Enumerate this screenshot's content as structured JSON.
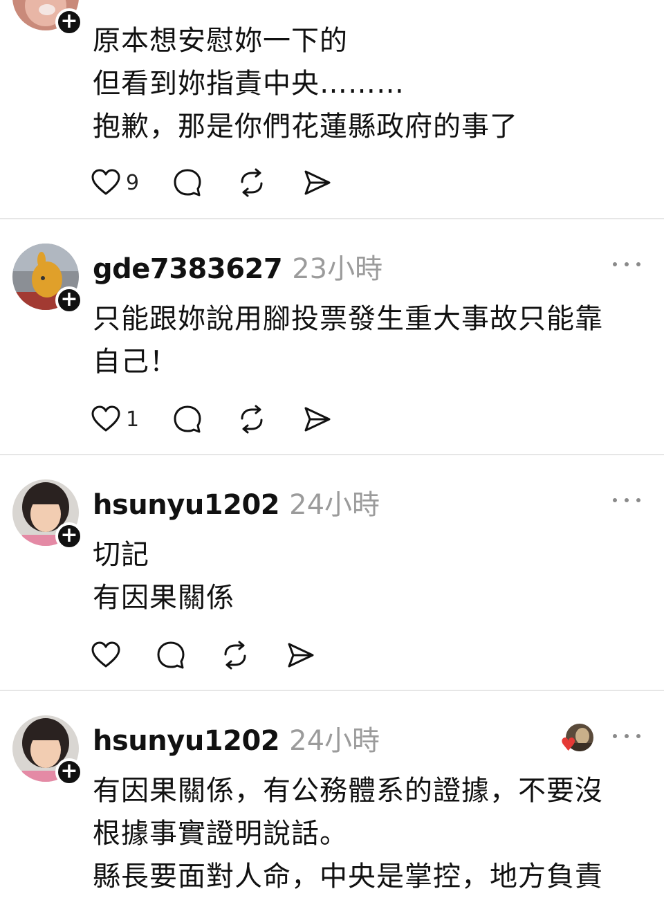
{
  "posts": [
    {
      "username": "",
      "time": "",
      "lines": [
        "原本想安慰妳一下的",
        "但看到妳指責中央………",
        "抱歉，那是你們花蓮縣政府的事了"
      ],
      "likes": "9"
    },
    {
      "username": "gde7383627",
      "time": "23小時",
      "lines": [
        "只能跟妳說用腳投票發生重大事故只能靠",
        "自己！"
      ],
      "likes": "1"
    },
    {
      "username": "hsunyu1202",
      "time": "24小時",
      "lines": [
        "切記",
        "有因果關係"
      ],
      "likes": ""
    },
    {
      "username": "hsunyu1202",
      "time": "24小時",
      "lines": [
        "有因果關係，有公務體系的證據，不要沒",
        "根據事實證明說話。",
        "縣長要面對人命，中央是掌控，地方負責"
      ],
      "likes": ""
    }
  ],
  "icons": {
    "like": "heart-icon",
    "comment": "comment-icon",
    "repost": "repost-icon",
    "share": "share-icon",
    "more": "more-icon",
    "follow": "plus-icon"
  },
  "colors": {
    "text": "#111111",
    "muted": "#9b9b9b",
    "divider": "#e6e6e6",
    "badge": "#111111"
  }
}
